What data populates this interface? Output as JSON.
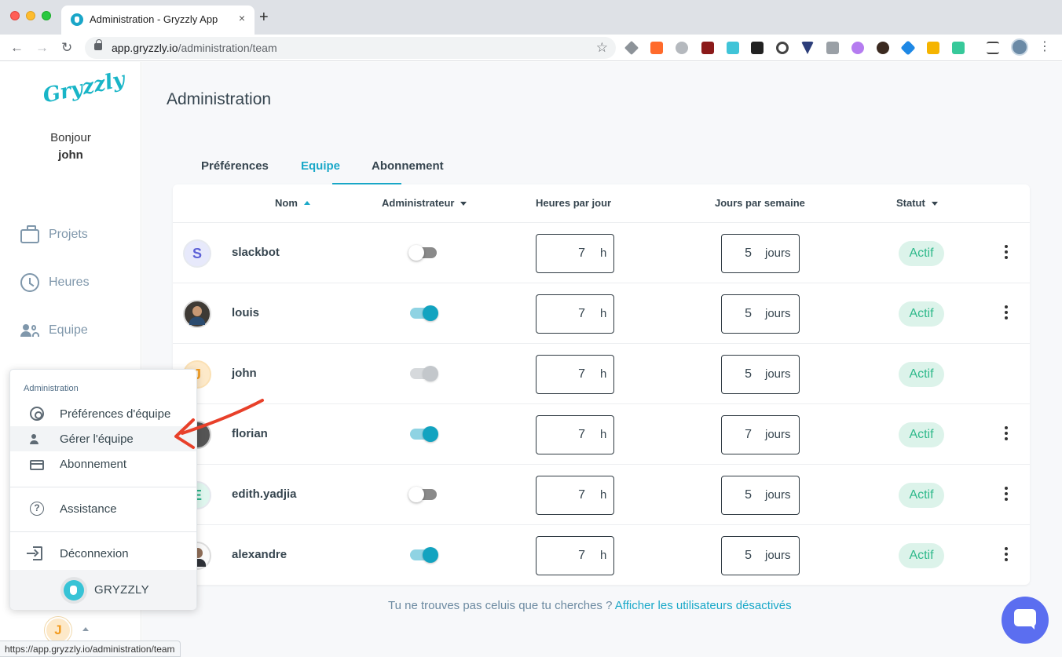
{
  "browser": {
    "tab_title": "Administration - Gryzzly App",
    "new_tab": "+",
    "tab_close": "×",
    "back": "←",
    "forward": "→",
    "reload": "↻",
    "url_host": "app.gryzzly.io",
    "url_path": "/administration/team",
    "bookmark": "☆",
    "menu": "⋮",
    "status_url": "https://app.gryzzly.io/administration/team",
    "extensions": [
      "drive-icon",
      "zapier-icon",
      "chat-icon",
      "ublock-icon",
      "cube-icon",
      "new-icon",
      "web-icon",
      "vue-icon",
      "css-icon",
      "feather-icon",
      "person-icon",
      "box-icon",
      "note-icon",
      "notion-icon",
      "playlist-icon"
    ]
  },
  "sidebar": {
    "logo": "Gryzzly",
    "greeting": "Bonjour",
    "username": "john",
    "nav": [
      {
        "label": "Projets",
        "icon": "briefcase-icon"
      },
      {
        "label": "Heures",
        "icon": "clock-icon"
      },
      {
        "label": "Equipe",
        "icon": "team-icon"
      }
    ],
    "user_initial": "J"
  },
  "popup": {
    "heading": "Administration",
    "items": [
      {
        "label": "Préférences d'équipe",
        "icon": "gear-icon"
      },
      {
        "label": "Gérer l'équipe",
        "icon": "people-icon"
      },
      {
        "label": "Abonnement",
        "icon": "credit-card-icon"
      },
      {
        "label": "Assistance",
        "icon": "help-icon"
      },
      {
        "label": "Déconnexion",
        "icon": "logout-icon"
      }
    ],
    "help_glyph": "?",
    "company": "GRYZZLY"
  },
  "page": {
    "title": "Administration",
    "tabs": [
      "Préférences",
      "Equipe",
      "Abonnement"
    ],
    "active_tab": "Equipe"
  },
  "table": {
    "headers": {
      "name": "Nom",
      "admin": "Administrateur",
      "hours": "Heures par jour",
      "days": "Jours par semaine",
      "status": "Statut"
    },
    "rows": [
      {
        "initial": "S",
        "name": "slackbot",
        "admin": "off",
        "hours": "7",
        "hours_unit": "h",
        "days": "5",
        "days_unit": "jours",
        "status": "Actif"
      },
      {
        "initial": "",
        "name": "louis",
        "admin": "on",
        "hours": "7",
        "hours_unit": "h",
        "days": "5",
        "days_unit": "jours",
        "status": "Actif"
      },
      {
        "initial": "J",
        "name": "john",
        "admin": "disabled",
        "hours": "7",
        "hours_unit": "h",
        "days": "5",
        "days_unit": "jours",
        "status": "Actif"
      },
      {
        "initial": "",
        "name": "florian",
        "admin": "on",
        "hours": "7",
        "hours_unit": "h",
        "days": "7",
        "days_unit": "jours",
        "status": "Actif"
      },
      {
        "initial": "E",
        "name": "edith.yadjia",
        "admin": "off",
        "hours": "7",
        "hours_unit": "h",
        "days": "5",
        "days_unit": "jours",
        "status": "Actif"
      },
      {
        "initial": "",
        "name": "alexandre",
        "admin": "on",
        "hours": "7",
        "hours_unit": "h",
        "days": "5",
        "days_unit": "jours",
        "status": "Actif"
      }
    ]
  },
  "footer": {
    "question": "Tu ne trouves pas celuis que tu cherches ?",
    "link": "Afficher les utilisateurs désactivés"
  },
  "colors": {
    "accent": "#19a8c8",
    "status_bg": "#dcf3ea",
    "status_text": "#2fb98b",
    "annotation_arrow": "#e8402a",
    "chat": "#5b6ef0"
  }
}
